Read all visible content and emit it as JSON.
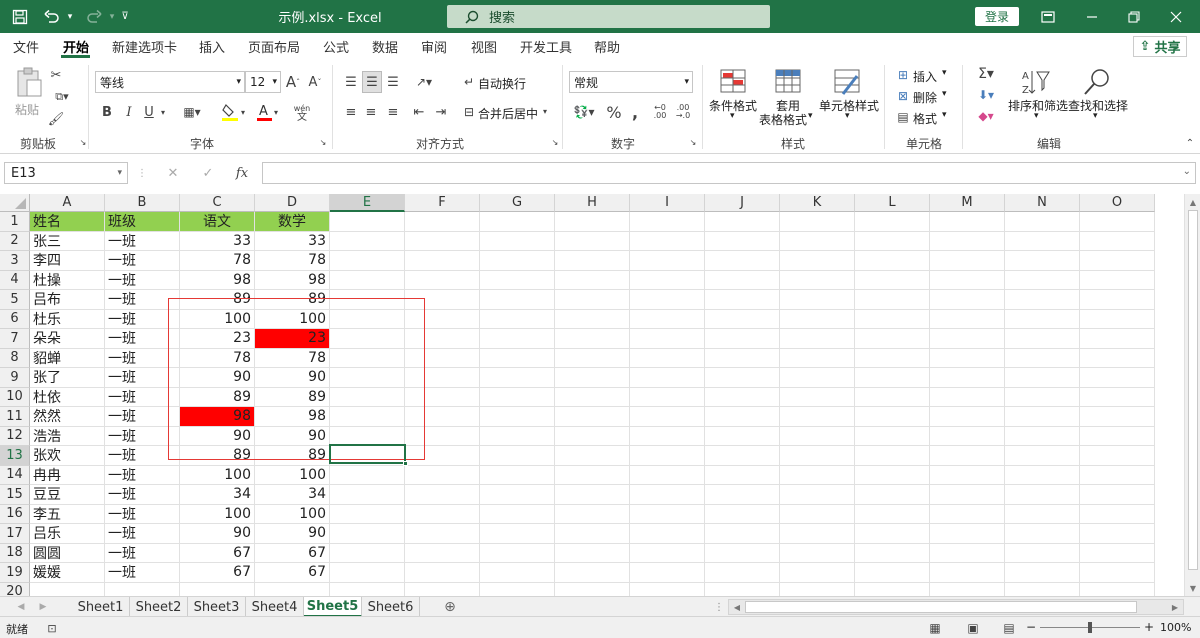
{
  "titlebar": {
    "file_title": "示例.xlsx  -  Excel",
    "search_placeholder": "搜索",
    "login_label": "登录",
    "icons": [
      "save-icon",
      "undo-icon",
      "redo-icon",
      "customize-icon",
      "ribbon-display-icon",
      "minimize-icon",
      "restore-icon",
      "close-icon"
    ]
  },
  "tabs": [
    "文件",
    "开始",
    "新建选项卡",
    "插入",
    "页面布局",
    "公式",
    "数据",
    "审阅",
    "视图",
    "开发工具",
    "帮助"
  ],
  "active_tab": "开始",
  "share_label": "共享",
  "ribbon": {
    "clipboard": {
      "label": "剪贴板",
      "paste": "粘贴"
    },
    "font": {
      "label": "字体",
      "name": "等线",
      "size": "12",
      "bold": "B",
      "italic": "I",
      "underline": "U",
      "phonetic": "wén"
    },
    "alignment": {
      "label": "对齐方式",
      "wrap": "自动换行",
      "merge": "合并后居中"
    },
    "number": {
      "label": "数字",
      "format": "常规"
    },
    "styles": {
      "label": "样式",
      "conditional": "条件格式",
      "table_line1": "套用",
      "table_line2": "表格格式",
      "cell_styles": "单元格样式"
    },
    "cells": {
      "label": "单元格",
      "insert": "插入",
      "delete": "删除",
      "format": "格式"
    },
    "editing": {
      "label": "编辑",
      "sort": "排序和筛选",
      "find": "查找和选择"
    }
  },
  "formula_bar": {
    "name_box": "E13",
    "fx": "fx",
    "value": ""
  },
  "columns": [
    "A",
    "B",
    "C",
    "D",
    "E",
    "F",
    "G",
    "H",
    "I",
    "J",
    "K",
    "L",
    "M",
    "N",
    "O"
  ],
  "selected_column": "E",
  "selected_row": 13,
  "header_row": [
    "姓名",
    "班级",
    "语文",
    "数学"
  ],
  "rows": [
    [
      "张三",
      "一班",
      "33",
      "33"
    ],
    [
      "李四",
      "一班",
      "78",
      "78"
    ],
    [
      "杜操",
      "一班",
      "98",
      "98"
    ],
    [
      "吕布",
      "一班",
      "89",
      "89"
    ],
    [
      "杜乐",
      "一班",
      "100",
      "100"
    ],
    [
      "朵朵",
      "一班",
      "23",
      "23"
    ],
    [
      "貂蝉",
      "一班",
      "78",
      "78"
    ],
    [
      "张了",
      "一班",
      "90",
      "90"
    ],
    [
      "杜依",
      "一班",
      "89",
      "89"
    ],
    [
      "然然",
      "一班",
      "98",
      "98"
    ],
    [
      "浩浩",
      "一班",
      "90",
      "90"
    ],
    [
      "张欢",
      "一班",
      "89",
      "89"
    ],
    [
      "冉冉",
      "一班",
      "100",
      "100"
    ],
    [
      "豆豆",
      "一班",
      "34",
      "34"
    ],
    [
      "李五",
      "一班",
      "100",
      "100"
    ],
    [
      "吕乐",
      "一班",
      "90",
      "90"
    ],
    [
      "圆圆",
      "一班",
      "67",
      "67"
    ],
    [
      "媛媛",
      "一班",
      "67",
      "67"
    ]
  ],
  "row_numbers": [
    "1",
    "2",
    "3",
    "4",
    "5",
    "6",
    "7",
    "8",
    "9",
    "10",
    "11",
    "12",
    "13",
    "14",
    "15",
    "16",
    "17",
    "18",
    "19",
    "20"
  ],
  "highlighted_cells": [
    {
      "row": 7,
      "col": "D"
    },
    {
      "row": 11,
      "col": "C"
    }
  ],
  "colors": {
    "header_fill": "#92d050",
    "highlight_fill": "#ff0000",
    "annotation_border": "#e53935",
    "excel_green": "#217346"
  },
  "sheets": [
    "Sheet1",
    "Sheet2",
    "Sheet3",
    "Sheet4",
    "Sheet5",
    "Sheet6"
  ],
  "active_sheet": "Sheet5",
  "status": {
    "ready": "就绪",
    "zoom": "100%",
    "minus": "−",
    "plus": "+"
  }
}
